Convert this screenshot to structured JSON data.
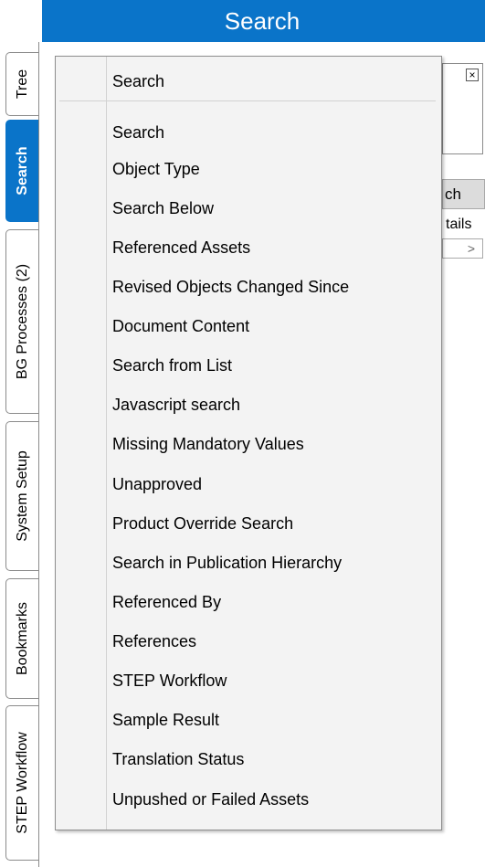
{
  "panel": {
    "title": "Search"
  },
  "tabs": [
    {
      "label": "Tree",
      "active": false
    },
    {
      "label": "Search",
      "active": true
    },
    {
      "label": "BG Processes (2)",
      "active": false
    },
    {
      "label": "System Setup",
      "active": false
    },
    {
      "label": "Bookmarks",
      "active": false
    },
    {
      "label": "STEP Workflow",
      "active": false
    }
  ],
  "background": {
    "close_glyph": "×",
    "button_label": "ch",
    "details_label": "tails",
    "select_arrow": ">"
  },
  "menu": {
    "header_label": "Search",
    "items": [
      "Search",
      "Object Type",
      "Search Below",
      "Referenced Assets",
      "Revised Objects Changed Since",
      "Document Content",
      "Search from List",
      "Javascript search",
      "Missing Mandatory Values",
      "Unapproved",
      "Product Override Search",
      "Search in Publication Hierarchy",
      "Referenced By",
      "References",
      "STEP Workflow",
      "Sample Result",
      "Translation Status",
      "Unpushed or Failed Assets"
    ]
  },
  "colors": {
    "accent": "#0a74c9",
    "menu_bg": "#f3f3f3"
  }
}
